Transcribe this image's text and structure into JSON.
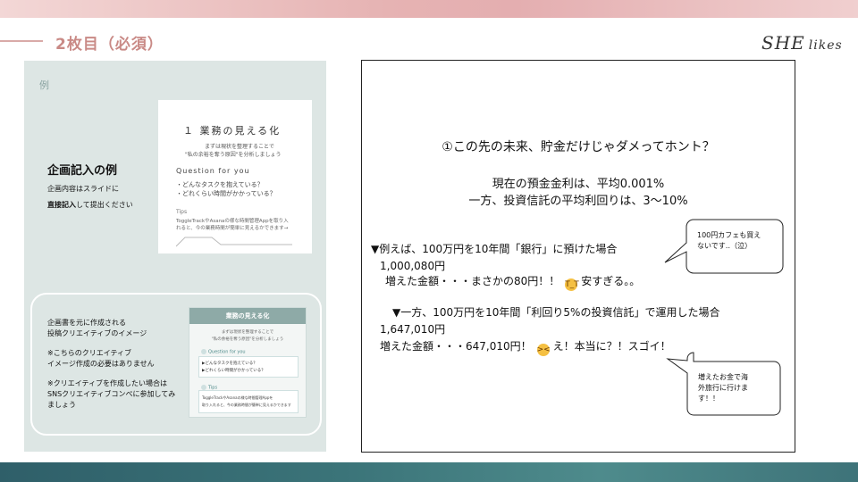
{
  "header": {
    "title": "2枚目（必須）",
    "logo_main": "SHE",
    "logo_sub": "likes"
  },
  "example_panel": {
    "label": "例",
    "heading": "企画記入の例",
    "line1": "企画内容はスライドに",
    "line2_bold": "直接記入",
    "line2_rest": "して提出ください",
    "sample_card": {
      "title": "１ 業務の見える化",
      "sub1": "まずは現状を整理することで",
      "sub2": "\"私の余裕を奪う原因\"を分析しましょう",
      "question": "Question for you",
      "bullet1": "・どんなタスクを抱えている？",
      "bullet2": "・どれくらい時間がかかっている？",
      "tips": "Tips",
      "tip1": "TogglеTrackやAsanaの様な時間管理Appを取り入",
      "tip2": "れると、今の業務時間が簡単に見えるかできます→"
    },
    "notes": {
      "n1_l1": "企画書を元に作成される",
      "n1_l2": "投稿クリエイティブのイメージ",
      "n2_l1": "※こちらのクリエイティブ",
      "n2_l2": "イメージ作成の必要はありません",
      "n3_l1": "※クリエイティブを作成したい場合は",
      "n3_l2": "SNSクリエイティブコンペに参加してみ",
      "n3_l3": "ましょう"
    },
    "mini_card": {
      "head": "業務の見える化",
      "sub1": "まずは現状を整理することで",
      "sub2": "\"私の余裕を奪う原因\"を分析しましょう",
      "question": "Question for you",
      "b1": "▶どんなタスクを抱えている？",
      "b2": "▶どれくらい時間がかかっている？",
      "tips": "Tips",
      "t1": "TogglеTrackやAsanaの様な時間管理Appを",
      "t2": "取り入れると、今の業務時間が簡単に見えるかできます"
    }
  },
  "content": {
    "question": "①この先の未来、貯金だけじゃダメってホント？",
    "rate1": "現在の預金金利は、平均0.001%",
    "rate2": "一方、投資信託の平均利回りは、3〜10%",
    "ex1": "▼例えば、100万円を10年間「銀行」に預けた場合",
    "ex1_amount": "1,000,080円",
    "ex1_gain": "増えた金額・・・まさかの80円！！",
    "ex1_comment": "安すぎる。。",
    "ex2": "▼一方、100万円を10年間「利回り5%の投資信託」で運用した場合",
    "ex2_amount": "1,647,010円",
    "ex2_gain": "増えた金額・・・647,010円！",
    "ex2_comment": "え！本当に？！スゴイ！",
    "bubble1_l1": "100円カフェも買え",
    "bubble1_l2": "ないです‥（泣）",
    "bubble2_l1": "増えたお金で海",
    "bubble2_l2": "外旅行に行けま",
    "bubble2_l3": "す！！"
  },
  "colors": {
    "accent": "#c98a86",
    "panel": "#dde6e4",
    "teal": "#3b7479"
  },
  "icons": {
    "crying": "crying-face-icon",
    "laughing": "laughing-face-icon"
  }
}
